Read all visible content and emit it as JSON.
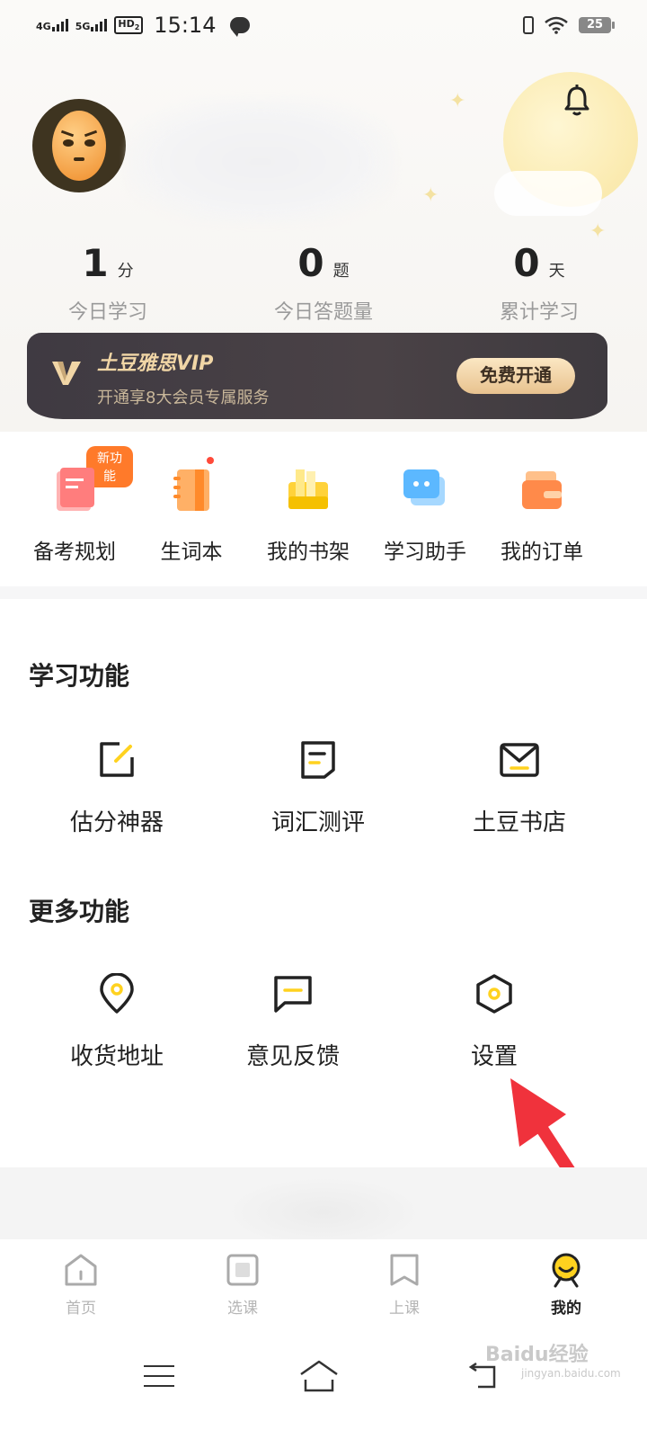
{
  "status_bar": {
    "net1": "4G",
    "net2": "5G",
    "hd": "HD",
    "hd_sub": "2",
    "time": "15:14",
    "battery": "25"
  },
  "profile": {
    "notification_icon": "bell-icon"
  },
  "stats": [
    {
      "value": "1",
      "unit": "分",
      "label": "今日学习"
    },
    {
      "value": "0",
      "unit": "题",
      "label": "今日答题量"
    },
    {
      "value": "0",
      "unit": "天",
      "label": "累计学习"
    }
  ],
  "vip": {
    "title": "土豆雅思VIP",
    "subtitle": "开通享8大会员专属服务",
    "button": "免费开通"
  },
  "quick_items": [
    {
      "label": "备考规划",
      "badge": "新功能",
      "icon": "planner-icon",
      "color": "#ff8a8a"
    },
    {
      "label": "生词本",
      "icon": "notebook-icon",
      "color": "#ff9a4a"
    },
    {
      "label": "我的书架",
      "icon": "bookshelf-icon",
      "color": "#ffd23a"
    },
    {
      "label": "学习助手",
      "icon": "chat-assistant-icon",
      "color": "#5cb8ff"
    },
    {
      "label": "我的订单",
      "icon": "wallet-icon",
      "color": "#ff8a4a"
    }
  ],
  "study_section": {
    "title": "学习功能",
    "items": [
      {
        "label": "估分神器",
        "icon": "edit-score-icon"
      },
      {
        "label": "词汇测评",
        "icon": "document-icon"
      },
      {
        "label": "土豆书店",
        "icon": "mail-store-icon"
      }
    ]
  },
  "more_section": {
    "title": "更多功能",
    "items": [
      {
        "label": "收货地址",
        "icon": "location-pin-icon"
      },
      {
        "label": "意见反馈",
        "icon": "feedback-icon"
      },
      {
        "label": "设置",
        "icon": "settings-hex-icon"
      }
    ]
  },
  "tabs": [
    {
      "label": "首页",
      "icon": "home-tab-icon"
    },
    {
      "label": "选课",
      "icon": "course-tab-icon"
    },
    {
      "label": "上课",
      "icon": "bookmark-tab-icon"
    },
    {
      "label": "我的",
      "icon": "profile-tab-icon",
      "active": true
    }
  ],
  "watermark": {
    "text": "Baidu经验",
    "sub": "jingyan.baidu.com"
  },
  "colors": {
    "accent": "#ffd21f",
    "vip_bg": "#433d42",
    "arrow": "#f0323c"
  }
}
